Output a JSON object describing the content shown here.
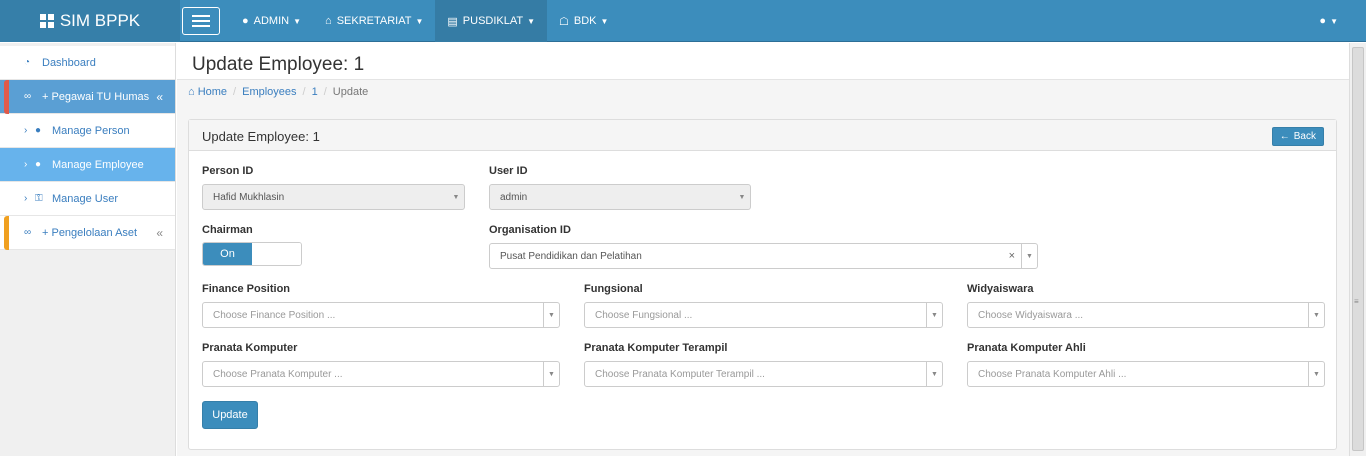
{
  "app": {
    "brand": "SIM BPPK"
  },
  "topnav": [
    {
      "label": "ADMIN",
      "icon": "android-icon"
    },
    {
      "label": "SEKRETARIAT",
      "icon": "home-icon"
    },
    {
      "label": "PUSDIKLAT",
      "icon": "book-icon",
      "active": true
    },
    {
      "label": "BDK",
      "icon": "institution-icon"
    }
  ],
  "sidebar": {
    "dashboard": "Dashboard",
    "group1": {
      "label": "+ Pegawai TU Humas",
      "chevron": "«"
    },
    "items": [
      {
        "label": "Manage Person"
      },
      {
        "label": "Manage Employee"
      },
      {
        "label": "Manage User"
      }
    ],
    "group2": {
      "label": "+ Pengelolaan Aset",
      "chevron": "«"
    }
  },
  "page": {
    "title": "Update Employee: 1",
    "breadcrumb": {
      "home": "Home",
      "employees": "Employees",
      "id": "1",
      "current": "Update"
    }
  },
  "panel": {
    "title": "Update Employee: 1",
    "back_label": "Back"
  },
  "form": {
    "person_id": {
      "label": "Person ID",
      "value": "Hafid Mukhlasin"
    },
    "user_id": {
      "label": "User ID",
      "value": "admin"
    },
    "chairman": {
      "label": "Chairman",
      "state": "On"
    },
    "organisation_id": {
      "label": "Organisation ID",
      "value": "Pusat Pendidikan dan Pelatihan",
      "clear": "×"
    },
    "finance_position": {
      "label": "Finance Position",
      "placeholder": "Choose Finance Position ..."
    },
    "fungsional": {
      "label": "Fungsional",
      "placeholder": "Choose Fungsional ..."
    },
    "widyaiswara": {
      "label": "Widyaiswara",
      "placeholder": "Choose Widyaiswara ..."
    },
    "pranata_komputer": {
      "label": "Pranata Komputer",
      "placeholder": "Choose Pranata Komputer ..."
    },
    "pranata_komputer_terampil": {
      "label": "Pranata Komputer Terampil",
      "placeholder": "Choose Pranata Komputer Terampil ..."
    },
    "pranata_komputer_ahli": {
      "label": "Pranata Komputer Ahli",
      "placeholder": "Choose Pranata Komputer Ahli ..."
    },
    "submit_label": "Update"
  },
  "colors": {
    "navbar": "#3c8dbc",
    "brand_bg": "#367fa9",
    "active_side": "#67b3ec",
    "group_side": "#5a9fd4"
  }
}
